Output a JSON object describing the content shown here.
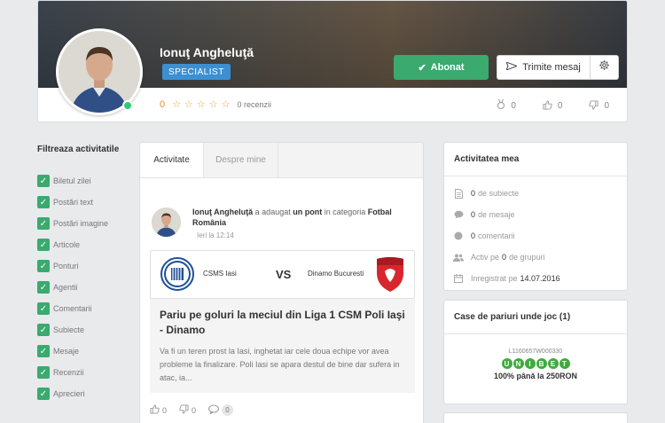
{
  "profile": {
    "name": "Ionuţ Angheluţă",
    "role": "SPECIALIST",
    "follow_label": "Abonat",
    "message_label": "Trimite mesaj",
    "rating_score": "0",
    "stars": 5,
    "reviews": "0 recenzii",
    "stats": {
      "followers": "0",
      "likes": "0",
      "dislikes": "0"
    },
    "online": true
  },
  "filter": {
    "title": "Filtreaza activitatile",
    "items": [
      "Biletul zilei",
      "Postări text",
      "Postări imagine",
      "Articole",
      "Ponturi",
      "Agentii",
      "Comentarii",
      "Subiecte",
      "Mesaje",
      "Recenzii",
      "Aprecieri"
    ]
  },
  "activity": {
    "tabs": [
      "Activitate",
      "Despre mine"
    ],
    "post": {
      "author": "Ionuţ Angheluţă",
      "action": "a adaugat",
      "object": "un pont",
      "in_category": "in categoria",
      "category": "Fotbal România",
      "time": "Ieri la 12:14",
      "team1": "CSMS Iasi",
      "vs": "VS",
      "team2": "Dinamo Bucuresti",
      "title": "Pariu pe goluri la meciul din Liga 1 CSM Poli Iaşi - Dinamo",
      "excerpt": "Va fi un teren prost la Iasi, inghetat iar cele doua echipe vor avea probleme la finalizare. Poli Iasi se apara destul de bine dar sufera in atac, ia...",
      "likes": "0",
      "dislikes": "0",
      "comments": "0"
    }
  },
  "my_activity": {
    "title": "Activitatea mea",
    "items": [
      {
        "icon": "document-icon",
        "num": "0",
        "text": "de subiecte"
      },
      {
        "icon": "chat-bubble-icon",
        "num": "0",
        "text": "de mesaje"
      },
      {
        "icon": "comment-icon",
        "num": "0",
        "text": "comentarii"
      },
      {
        "icon": "group-icon",
        "prefix": "Activ pe",
        "num": "0",
        "text": "de grupuri"
      },
      {
        "icon": "calendar-icon",
        "prefix": "Inregistrat pe",
        "value": "14.07.2016"
      }
    ]
  },
  "betting": {
    "title": "Case de pariuri unde joc (1)",
    "code": "L1160657W000330",
    "brand": [
      "U",
      "N",
      "I",
      "B",
      "E",
      "T"
    ],
    "offer": "100% până la 250RON"
  },
  "colors": {
    "green": "#3aaa6f",
    "blue": "#3d8fd1",
    "star": "#e8a23b"
  }
}
